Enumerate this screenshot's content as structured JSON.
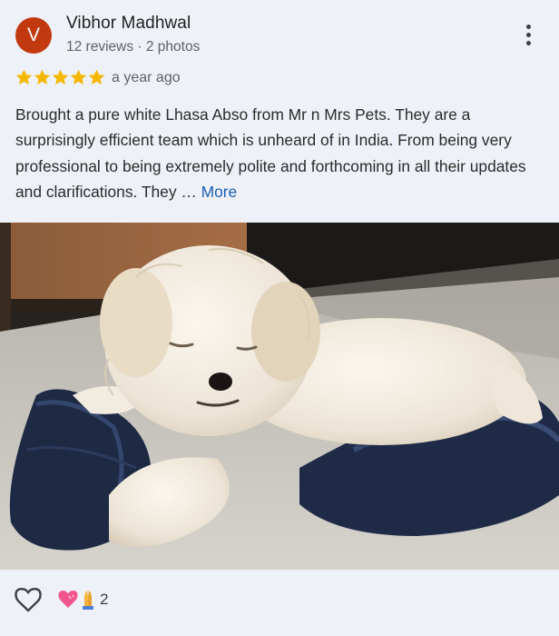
{
  "author": {
    "initial": "V",
    "name": "Vibhor Madhwal",
    "meta": "12 reviews · 2 photos",
    "avatar_color": "#c2380f"
  },
  "rating": {
    "stars": 5,
    "max": 5,
    "star_color": "#f5b800",
    "date": "a year ago"
  },
  "review": {
    "text": "Brought a pure white Lhasa Abso from Mr n Mrs Pets. They are a surprisingly efficient team which is unheard of in India. From being very professional to being extremely polite and forthcoming in all their updates and clarifications. They … ",
    "more_label": "More"
  },
  "photo": {
    "subject": "white-puppy-on-slippers"
  },
  "reactions": {
    "icons": [
      "heart-emoji",
      "folded-hands-emoji"
    ],
    "count": "2"
  },
  "icons": {
    "menu": "more-vert-icon",
    "like": "heart-outline-icon"
  }
}
